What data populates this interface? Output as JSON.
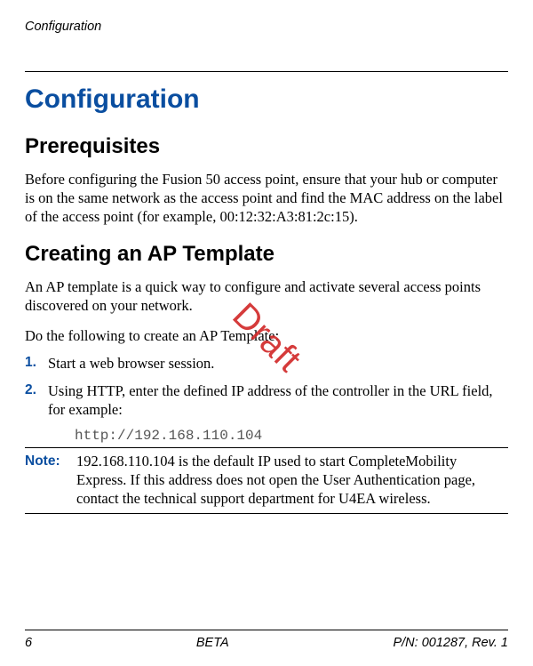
{
  "header": {
    "running_title": "Configuration"
  },
  "title": "Configuration",
  "section1": {
    "heading": "Prerequisites",
    "body": "Before configuring the Fusion 50 access point, ensure that your hub or computer is on the same network as the access point and find the MAC address on the label of the access point (for example, 00:12:32:A3:81:2c:15)."
  },
  "section2": {
    "heading": "Creating an AP Template",
    "intro1": "An AP template is a quick way to configure and activate several access points discovered on your network.",
    "intro2": "Do the following to create an AP Template:",
    "steps": [
      {
        "num": "1.",
        "text": "Start a web browser session."
      },
      {
        "num": "2.",
        "text": "Using HTTP, enter the defined IP address of the controller in the URL field, for example:"
      }
    ],
    "code": "http://192.168.110.104",
    "note_label": "Note:",
    "note_body": "192.168.110.104 is the default IP used to start CompleteMobility Express. If this address does not open the User Authentication page, contact the technical support department for U4EA wireless."
  },
  "watermark": "Draft",
  "footer": {
    "page": "6",
    "center": "BETA",
    "right": "P/N: 001287, Rev. 1"
  }
}
